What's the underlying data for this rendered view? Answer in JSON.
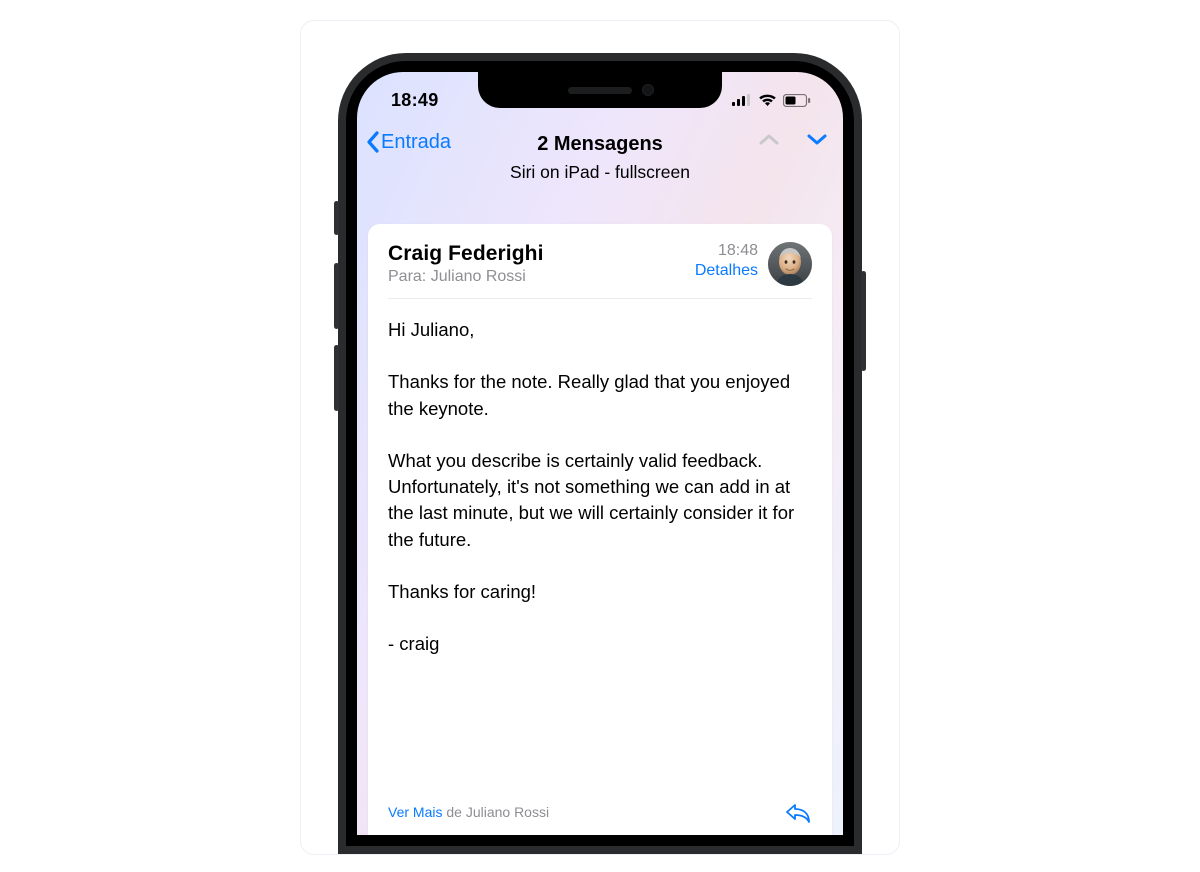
{
  "statusbar": {
    "time": "18:49"
  },
  "nav": {
    "back_label": "Entrada",
    "title": "2 Mensagens",
    "subtitle": "Siri on iPad - fullscreen"
  },
  "message": {
    "from": "Craig Federighi",
    "to_label": "Para:",
    "to_name": "Juliano Rossi",
    "time": "18:48",
    "details_label": "Detalhes",
    "body": {
      "p1": "Hi Juliano,",
      "p2": "Thanks for the note.  Really glad that you enjoyed the keynote.",
      "p3": "What you describe is certainly valid feedback.  Unfortunately, it's not something we can add in at the last minute, but we will certainly consider it for the future.",
      "p4": "Thanks for caring!",
      "p5": "- craig"
    },
    "footer": {
      "see_more": "Ver Mais",
      "see_more_suffix": " de Juliano Rossi"
    }
  },
  "colors": {
    "accent": "#0a7aff",
    "muted": "#8e8e93"
  }
}
